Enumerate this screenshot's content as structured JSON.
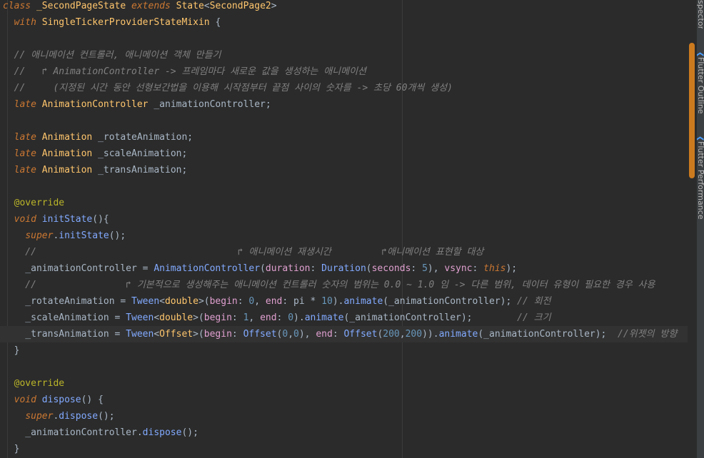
{
  "editor": {
    "lines": [
      [
        {
          "c": "kw",
          "t": "class "
        },
        {
          "c": "type",
          "t": "_SecondPageState "
        },
        {
          "c": "kw",
          "t": "extends "
        },
        {
          "c": "type",
          "t": "State"
        },
        {
          "c": "pl",
          "t": "<"
        },
        {
          "c": "type",
          "t": "SecondPage2"
        },
        {
          "c": "pl",
          "t": ">"
        }
      ],
      [
        {
          "c": "pl",
          "t": "  "
        },
        {
          "c": "kw",
          "t": "with "
        },
        {
          "c": "type",
          "t": "SingleTickerProviderStateMixin "
        },
        {
          "c": "brace",
          "t": "{"
        }
      ],
      [],
      [
        {
          "c": "cm",
          "t": "  // 애니메이션 컨트롤러, 애니메이션 객체 만들기"
        }
      ],
      [
        {
          "c": "cm",
          "t": "  //   ↱ AnimationController -> 프레임마다 새로운 값을 생성하는 애니메이션"
        }
      ],
      [
        {
          "c": "cm",
          "t": "  //     (지정된 시간 동안 선형보간법을 이용해 시작점부터 끝점 사이의 숫자를 -> 초당 60개씩 생성)"
        }
      ],
      [
        {
          "c": "pl",
          "t": "  "
        },
        {
          "c": "kw",
          "t": "late "
        },
        {
          "c": "type",
          "t": "AnimationController "
        },
        {
          "c": "pl",
          "t": "_animationController;"
        }
      ],
      [],
      [
        {
          "c": "pl",
          "t": "  "
        },
        {
          "c": "kw",
          "t": "late "
        },
        {
          "c": "type",
          "t": "Animation "
        },
        {
          "c": "pl",
          "t": "_rotateAnimation;"
        }
      ],
      [
        {
          "c": "pl",
          "t": "  "
        },
        {
          "c": "kw",
          "t": "late "
        },
        {
          "c": "type",
          "t": "Animation "
        },
        {
          "c": "pl",
          "t": "_scaleAnimation;"
        }
      ],
      [
        {
          "c": "pl",
          "t": "  "
        },
        {
          "c": "kw",
          "t": "late "
        },
        {
          "c": "type",
          "t": "Animation "
        },
        {
          "c": "pl",
          "t": "_transAnimation;"
        }
      ],
      [],
      [
        {
          "c": "pl",
          "t": "  "
        },
        {
          "c": "ann",
          "t": "@override"
        }
      ],
      [
        {
          "c": "pl",
          "t": "  "
        },
        {
          "c": "kw",
          "t": "void "
        },
        {
          "c": "fn",
          "t": "initState"
        },
        {
          "c": "pl",
          "t": "(){"
        }
      ],
      [
        {
          "c": "pl",
          "t": "    "
        },
        {
          "c": "kw",
          "t": "super"
        },
        {
          "c": "pl",
          "t": "."
        },
        {
          "c": "fn",
          "t": "initState"
        },
        {
          "c": "pl",
          "t": "();"
        }
      ],
      [
        {
          "c": "cm",
          "t": "    //                                    ↱ 애니메이션 재생시간         ↱애니메이션 표현할 대상"
        }
      ],
      [
        {
          "c": "pl",
          "t": "    _animationController = "
        },
        {
          "c": "fn",
          "t": "AnimationController"
        },
        {
          "c": "pl",
          "t": "("
        },
        {
          "c": "prm",
          "t": "duration"
        },
        {
          "c": "pl",
          "t": ": "
        },
        {
          "c": "fn",
          "t": "Duration"
        },
        {
          "c": "pl",
          "t": "("
        },
        {
          "c": "prm",
          "t": "seconds"
        },
        {
          "c": "pl",
          "t": ": "
        },
        {
          "c": "num",
          "t": "5"
        },
        {
          "c": "pl",
          "t": "), "
        },
        {
          "c": "prm",
          "t": "vsync"
        },
        {
          "c": "pl",
          "t": ": "
        },
        {
          "c": "kw",
          "t": "this"
        },
        {
          "c": "pl",
          "t": ");"
        }
      ],
      [
        {
          "c": "cm",
          "t": "    //                ↱ 기본적으로 생성해주는 애니메이션 컨트롤러 숫자의 범위는 0.0 ~ 1.0 임 -> 다른 범위, 데이터 유형이 필요한 경우 사용"
        }
      ],
      [
        {
          "c": "pl",
          "t": "    _rotateAnimation = "
        },
        {
          "c": "fn",
          "t": "Tween"
        },
        {
          "c": "pl",
          "t": "<"
        },
        {
          "c": "type",
          "t": "double"
        },
        {
          "c": "pl",
          "t": ">("
        },
        {
          "c": "prm",
          "t": "begin"
        },
        {
          "c": "pl",
          "t": ": "
        },
        {
          "c": "num",
          "t": "0"
        },
        {
          "c": "pl",
          "t": ", "
        },
        {
          "c": "prm",
          "t": "end"
        },
        {
          "c": "pl",
          "t": ": pi * "
        },
        {
          "c": "num",
          "t": "10"
        },
        {
          "c": "pl",
          "t": ")."
        },
        {
          "c": "fn",
          "t": "animate"
        },
        {
          "c": "pl",
          "t": "(_animationController); "
        },
        {
          "c": "cm",
          "t": "// 회전"
        }
      ],
      [
        {
          "c": "pl",
          "t": "    _scaleAnimation = "
        },
        {
          "c": "fn",
          "t": "Tween"
        },
        {
          "c": "pl",
          "t": "<"
        },
        {
          "c": "type",
          "t": "double"
        },
        {
          "c": "pl",
          "t": ">("
        },
        {
          "c": "prm",
          "t": "begin"
        },
        {
          "c": "pl",
          "t": ": "
        },
        {
          "c": "num",
          "t": "1"
        },
        {
          "c": "pl",
          "t": ", "
        },
        {
          "c": "prm",
          "t": "end"
        },
        {
          "c": "pl",
          "t": ": "
        },
        {
          "c": "num",
          "t": "0"
        },
        {
          "c": "pl",
          "t": ")."
        },
        {
          "c": "fn",
          "t": "animate"
        },
        {
          "c": "pl",
          "t": "(_animationController);        "
        },
        {
          "c": "cm",
          "t": "// 크기"
        }
      ],
      [
        {
          "c": "pl",
          "t": "    _transAnimation = "
        },
        {
          "c": "fn",
          "t": "Tween"
        },
        {
          "c": "pl",
          "t": "<"
        },
        {
          "c": "type",
          "t": "Offset"
        },
        {
          "c": "pl",
          "t": ">("
        },
        {
          "c": "prm",
          "t": "begin"
        },
        {
          "c": "pl",
          "t": ": "
        },
        {
          "c": "fn",
          "t": "Offset"
        },
        {
          "c": "pl",
          "t": "("
        },
        {
          "c": "num",
          "t": "0"
        },
        {
          "c": "pl",
          "t": ","
        },
        {
          "c": "num",
          "t": "0"
        },
        {
          "c": "pl",
          "t": "), "
        },
        {
          "c": "prm",
          "t": "end"
        },
        {
          "c": "pl",
          "t": ": "
        },
        {
          "c": "fn",
          "t": "Offset"
        },
        {
          "c": "pl",
          "t": "("
        },
        {
          "c": "num",
          "t": "200"
        },
        {
          "c": "pl",
          "t": ","
        },
        {
          "c": "num",
          "t": "200"
        },
        {
          "c": "pl",
          "t": "))."
        },
        {
          "c": "fn",
          "t": "animate"
        },
        {
          "c": "pl",
          "t": "(_animationController);  "
        },
        {
          "c": "cm",
          "t": "//위젯의 방향"
        }
      ],
      [
        {
          "c": "pl",
          "t": "  "
        },
        {
          "c": "brace",
          "t": "}"
        }
      ],
      [],
      [
        {
          "c": "pl",
          "t": "  "
        },
        {
          "c": "ann",
          "t": "@override"
        }
      ],
      [
        {
          "c": "pl",
          "t": "  "
        },
        {
          "c": "kw",
          "t": "void "
        },
        {
          "c": "fn",
          "t": "dispose"
        },
        {
          "c": "pl",
          "t": "() {"
        }
      ],
      [
        {
          "c": "pl",
          "t": "    "
        },
        {
          "c": "kw",
          "t": "super"
        },
        {
          "c": "pl",
          "t": "."
        },
        {
          "c": "fn",
          "t": "dispose"
        },
        {
          "c": "pl",
          "t": "();"
        }
      ],
      [
        {
          "c": "pl",
          "t": "    _animationController."
        },
        {
          "c": "fn",
          "t": "dispose"
        },
        {
          "c": "pl",
          "t": "();"
        }
      ],
      [
        {
          "c": "pl",
          "t": "  "
        },
        {
          "c": "brace",
          "t": "}"
        }
      ]
    ],
    "current_line": 20
  },
  "tool_window_tabs": [
    {
      "label": "spector",
      "icon": "flutter-inspector-icon"
    },
    {
      "label": "Flutter Outline",
      "icon": "flutter-outline-icon"
    },
    {
      "label": "Flutter Performance",
      "icon": "flutter-performance-icon"
    }
  ],
  "colors": {
    "background": "#2b2b2b",
    "scroll_thumb": "#cc7a1e",
    "keyword": "#cc7832",
    "type": "#ffc66d",
    "function": "#82aaff",
    "comment": "#808080",
    "number": "#6897bb",
    "annotation": "#bbb529"
  }
}
